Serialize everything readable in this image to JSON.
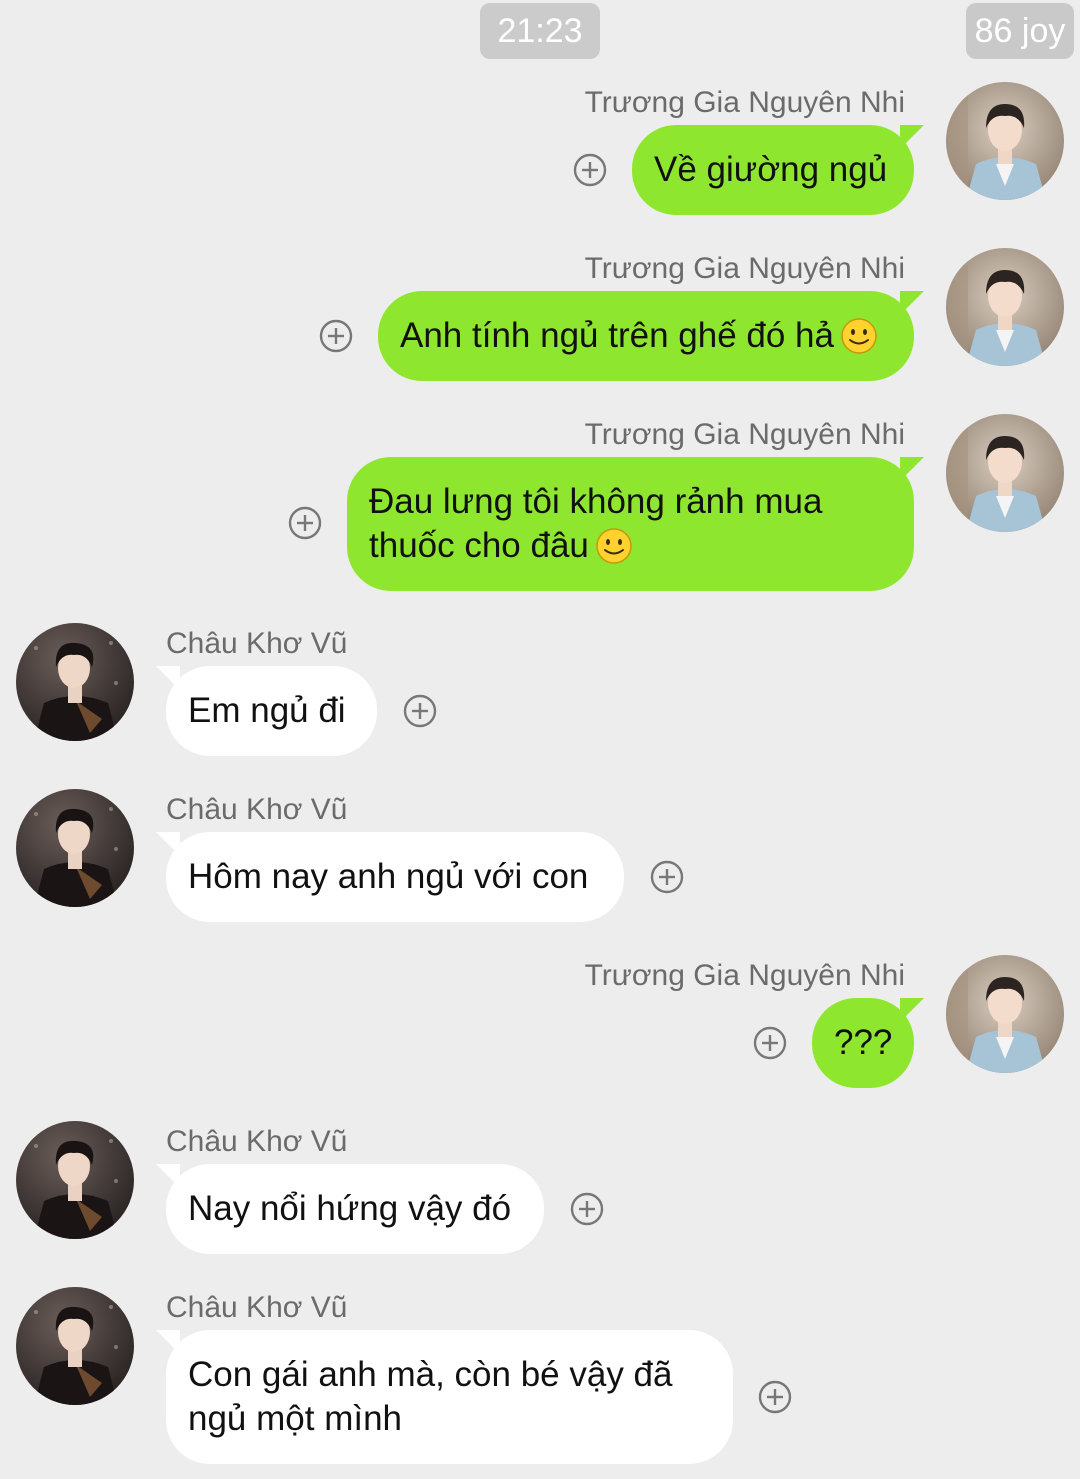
{
  "header": {
    "time": "21:23",
    "watermark": "86 joy"
  },
  "contacts": {
    "right_name": "Trương Gia Nguyên Nhi",
    "left_name": "Châu Khơ Vũ"
  },
  "messages": [
    {
      "side": "right",
      "sender": "Trương Gia Nguyên Nhi",
      "text": "Về giường ngủ",
      "emoji": null
    },
    {
      "side": "right",
      "sender": "Trương Gia Nguyên Nhi",
      "text": "Anh tính ngủ trên ghế đó hả",
      "emoji": "smile"
    },
    {
      "side": "right",
      "sender": "Trương Gia Nguyên Nhi",
      "text_line1": "Đau lưng tôi không rảnh mua",
      "text_line2": "thuốc cho đâu",
      "emoji": "smile"
    },
    {
      "side": "left",
      "sender": "Châu Khơ Vũ",
      "text": "Em ngủ đi",
      "emoji": null
    },
    {
      "side": "left",
      "sender": "Châu Khơ Vũ",
      "text": "Hôm nay anh ngủ với con",
      "emoji": null
    },
    {
      "side": "right",
      "sender": "Trương Gia Nguyên Nhi",
      "text": "???",
      "emoji": null
    },
    {
      "side": "left",
      "sender": "Châu Khơ Vũ",
      "text": "Nay nổi hứng vậy đó",
      "emoji": null
    },
    {
      "side": "left",
      "sender": "Châu Khơ Vũ",
      "text_line1": "Con gái anh mà, còn bé vậy đã",
      "text_line2": "ngủ một mình",
      "emoji": null
    }
  ],
  "colors": {
    "background": "#ededed",
    "outgoing_bubble": "#8fe62f",
    "incoming_bubble": "#ffffff",
    "name_text": "#6b6b6b"
  },
  "icons": {
    "add": "plus-circle-icon",
    "emoji": "smiley-emoji-icon"
  }
}
